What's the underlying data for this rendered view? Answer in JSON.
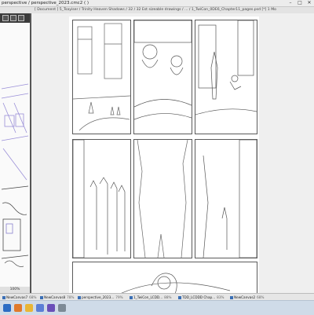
{
  "app": {
    "title": "perspective / perspective_2023.cmc2 ( )",
    "path_text": "[ Document ] 5_Tsayiser / Trinity Heaven Shadows / 32 / 32 Est sizeable drawings / ... / 1_TwiCon_0DE6_Chapter11_pages.psd [*] 1 Mo"
  },
  "window_controls": {
    "minimize": "–",
    "maximize": "□",
    "close": "✕"
  },
  "navigator": {
    "status": "100%"
  },
  "taskbar": {
    "tabs": [
      {
        "label": "NewCanvas7",
        "zoom": "68%"
      },
      {
        "label": "NewCanvas8",
        "zoom": "78%"
      },
      {
        "label": "perspective_2023...",
        "zoom": "79%"
      },
      {
        "label": "1_TwiCon_LCDD...",
        "zoom": "88%"
      },
      {
        "label": "TDD_LCDDD Chap...",
        "zoom": "83%"
      },
      {
        "label": "NewCanvas2",
        "zoom": "68%"
      }
    ]
  },
  "icons": {
    "navigator_tools": [
      "hand-icon",
      "zoom-icon",
      "rotate-icon"
    ],
    "system_tray": [
      "start-icon",
      "browser-icon",
      "folder-icon",
      "paint-icon",
      "chat-icon",
      "settings-icon"
    ]
  },
  "colors": {
    "accent": "#3a6fb5",
    "nav_head": "#3b3b3b",
    "ink": "#5a5a5a",
    "perspective_lines": "#9a8fd8"
  }
}
